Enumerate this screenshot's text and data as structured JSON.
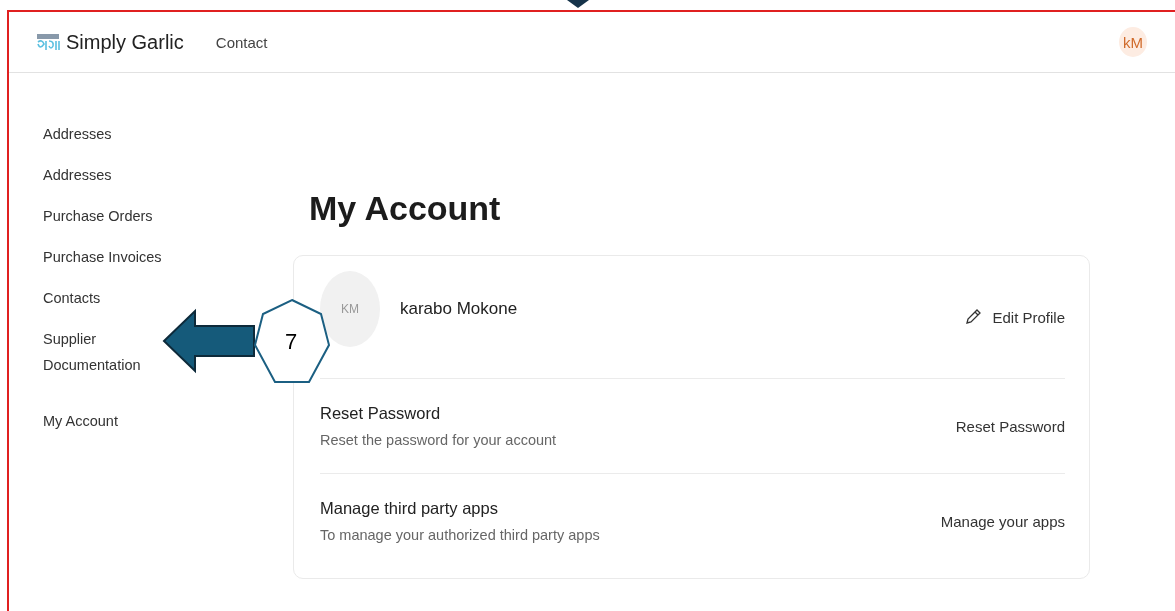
{
  "navbar": {
    "brand": "Simply Garlic",
    "links": [
      "Contact"
    ],
    "avatar": "kM"
  },
  "sidebar": {
    "items": [
      {
        "label": "Addresses"
      },
      {
        "label": "Addresses"
      },
      {
        "label": "Purchase Orders"
      },
      {
        "label": "Purchase Invoices"
      },
      {
        "label": "Contacts"
      },
      {
        "label": "Supplier Documentation"
      },
      {
        "label": "My Account"
      }
    ]
  },
  "page": {
    "title": "My Account",
    "profile": {
      "initials": "KM",
      "name": "karabo Mokone",
      "action": "Edit Profile"
    },
    "sections": [
      {
        "title": "Reset Password",
        "description": "Reset the password for your account",
        "action": "Reset Password"
      },
      {
        "title": "Manage third party apps",
        "description": "To manage your authorized third party apps",
        "action": "Manage your apps"
      }
    ]
  },
  "annotation": {
    "number": "7"
  }
}
